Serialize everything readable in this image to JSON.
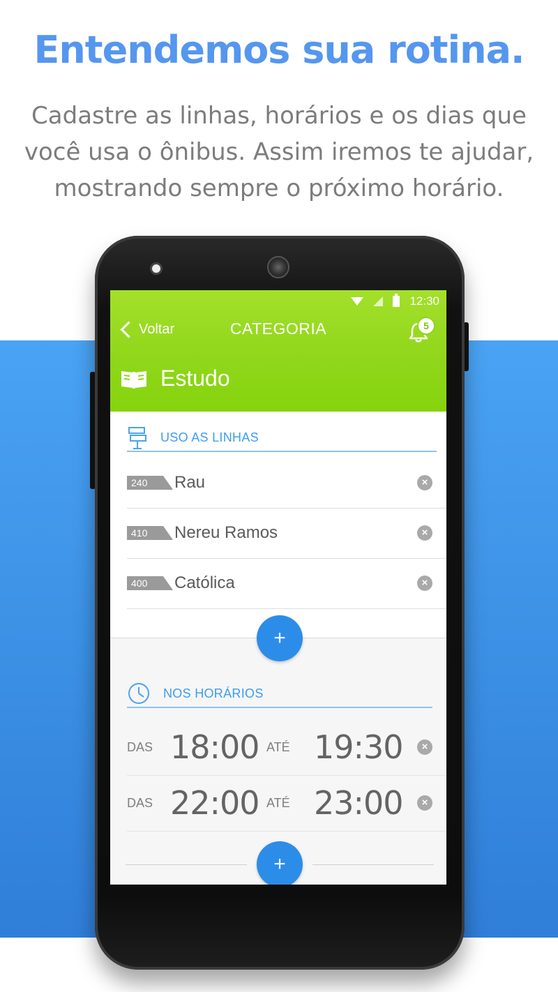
{
  "promo": {
    "headline": "Entendemos sua rotina.",
    "sub_line1": "Cadastre as linhas, horários e os dias que",
    "sub_line2": "você usa o ônibus. Assim iremos te ajudar,",
    "sub_line3": "mostrando sempre o próximo horário."
  },
  "status_bar": {
    "time": "12:30"
  },
  "header": {
    "back_label": "Voltar",
    "title": "CATEGORIA",
    "notification_count": "5"
  },
  "category": {
    "label": "Estudo",
    "icon": "book-icon"
  },
  "lines_section": {
    "title": "USO AS LINHAS",
    "icon": "signpost-icon",
    "items": [
      {
        "number": "240",
        "name": "Rau"
      },
      {
        "number": "410",
        "name": "Nereu Ramos"
      },
      {
        "number": "400",
        "name": "Católica"
      }
    ],
    "add_label": "+"
  },
  "times_section": {
    "title": "NOS HORÁRIOS",
    "icon": "clock-icon",
    "from_label": "DAS",
    "to_label": "ATÉ",
    "items": [
      {
        "from": "18:00",
        "to": "19:30"
      },
      {
        "from": "22:00",
        "to": "23:00"
      }
    ],
    "add_label": "+"
  },
  "colors": {
    "headline": "#5597ee",
    "appbar_green": "#8fd61a",
    "accent_blue": "#2c8de8",
    "band_blue": "#3b8fe4"
  }
}
